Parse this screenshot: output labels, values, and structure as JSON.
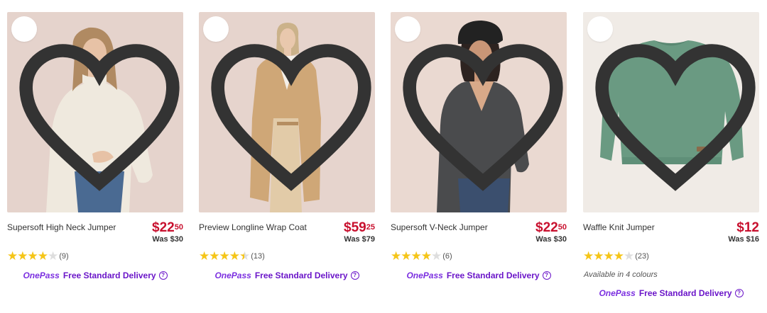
{
  "products": [
    {
      "name": "Supersoft High Neck Jumper",
      "price_dollars": "$22",
      "price_cents": "50",
      "was": "Was $30",
      "rating": 4,
      "review_count": "(9)",
      "onepass_label": "OnePass",
      "delivery": "Free Standard Delivery",
      "bg_color": "#e5d3cc"
    },
    {
      "name": "Preview Longline Wrap Coat",
      "price_dollars": "$59",
      "price_cents": "25",
      "was": "Was $79",
      "rating": 4.5,
      "review_count": "(13)",
      "onepass_label": "OnePass",
      "delivery": "Free Standard Delivery",
      "bg_color": "#e6d4cd"
    },
    {
      "name": "Supersoft V-Neck Jumper",
      "price_dollars": "$22",
      "price_cents": "50",
      "was": "Was $30",
      "rating": 4,
      "review_count": "(6)",
      "onepass_label": "OnePass",
      "delivery": "Free Standard Delivery",
      "bg_color": "#ead9d1"
    },
    {
      "name": "Waffle Knit Jumper",
      "price_dollars": "$12",
      "price_cents": "",
      "was": "Was $16",
      "rating": 4,
      "review_count": "(23)",
      "colours": "Available in 4 colours",
      "onepass_label": "OnePass",
      "delivery": "Free Standard Delivery",
      "bg_color": "#f0ebe6"
    }
  ],
  "colors": {
    "price_red": "#c8102e",
    "star_yellow": "#f5c518",
    "onepass_purple": "#7b2fe0"
  }
}
